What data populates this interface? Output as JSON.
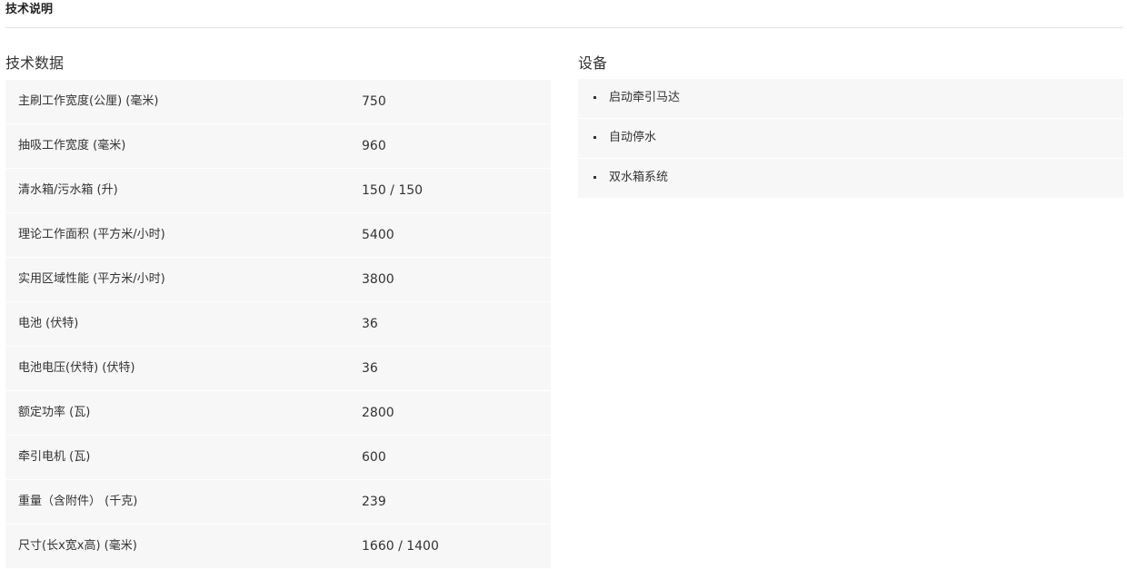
{
  "header": {
    "title": "技术说明"
  },
  "specs": {
    "heading": "技术数据",
    "rows": [
      {
        "label": "主刷工作宽度(公厘) (毫米)",
        "value": "750"
      },
      {
        "label": "抽吸工作宽度 (毫米)",
        "value": "960"
      },
      {
        "label": "清水箱/污水箱 (升)",
        "value": "150 / 150"
      },
      {
        "label": "理论工作面积 (平方米/小时)",
        "value": "5400"
      },
      {
        "label": "实用区域性能 (平方米/小时)",
        "value": "3800"
      },
      {
        "label": "电池 (伏特)",
        "value": "36"
      },
      {
        "label": "电池电压(伏特) (伏特)",
        "value": "36"
      },
      {
        "label": "额定功率 (瓦)",
        "value": "2800"
      },
      {
        "label": "牵引电机 (瓦)",
        "value": "600"
      },
      {
        "label": "重量（含附件） (千克)",
        "value": "239"
      },
      {
        "label": "尺寸(长x宽x高) (毫米)",
        "value": "1660 / 1400"
      }
    ]
  },
  "equipment": {
    "heading": "设备",
    "items": [
      "启动牵引马达",
      "自动停水",
      "双水箱系统"
    ]
  }
}
